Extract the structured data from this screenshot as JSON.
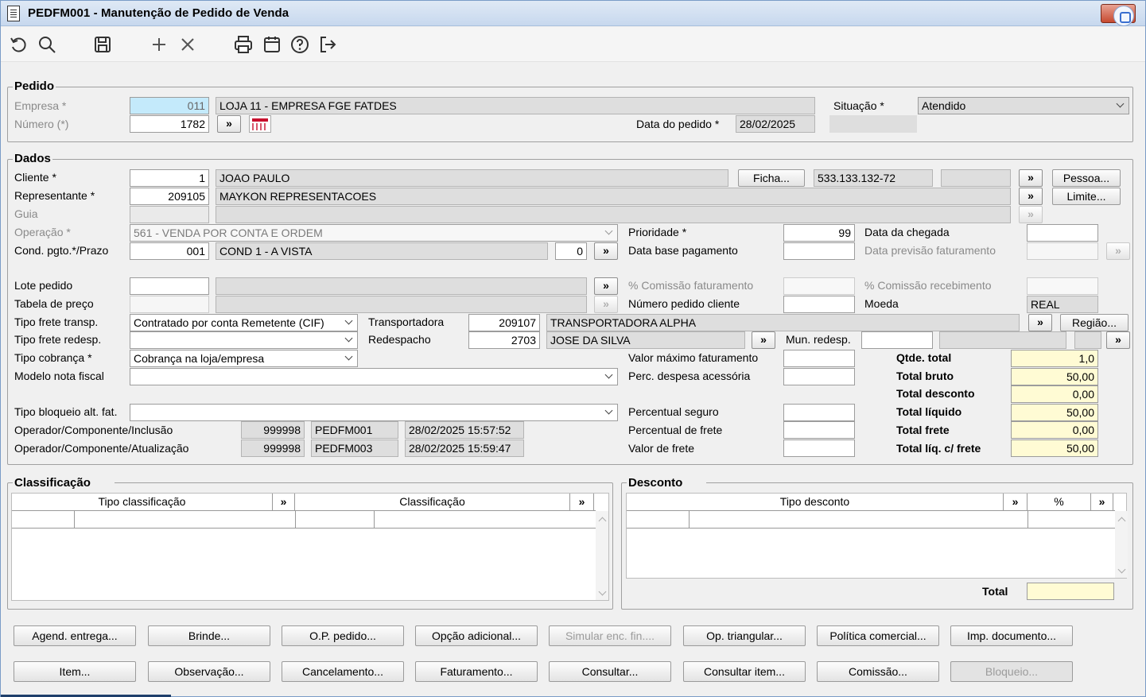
{
  "window": {
    "title": "PEDFM001 - Manutenção de Pedido de Venda"
  },
  "toolbar": {
    "icons": [
      "undo-icon",
      "search-icon",
      "save-icon",
      "add-icon",
      "delete-icon",
      "print-icon",
      "calendar-icon",
      "help-icon",
      "exit-icon"
    ]
  },
  "pedido": {
    "title": "Pedido",
    "empresa_label": "Empresa *",
    "empresa_code": "011",
    "empresa_name": "LOJA 11 - EMPRESA FGE FATDES",
    "numero_label": "Número (*)",
    "numero": "1782",
    "situacao_label": "Situação *",
    "situacao": "Atendido",
    "data_label": "Data do pedido *",
    "data": "28/02/2025"
  },
  "dados": {
    "title": "Dados",
    "cliente_label": "Cliente *",
    "cliente_code": "1",
    "cliente_name": "JOAO PAULO",
    "ficha_btn": "Ficha...",
    "cpf": "533.133.132-72",
    "pessoa_btn": "Pessoa...",
    "representante_label": "Representante *",
    "representante_code": "209105",
    "representante_name": "MAYKON REPRESENTACOES",
    "limite_btn": "Limite...",
    "guia_label": "Guia",
    "operacao_label": "Operação *",
    "operacao": "561 - VENDA POR CONTA E ORDEM",
    "prioridade_label": "Prioridade *",
    "prioridade": "99",
    "data_chegada_label": "Data da chegada",
    "cond_label": "Cond. pgto.*/Prazo",
    "cond_code": "001",
    "cond_name": "COND 1 - A VISTA",
    "prazo": "0",
    "data_base_label": "Data base pagamento",
    "data_prev_label": "Data previsão faturamento",
    "lote_label": "Lote pedido",
    "comissao_fat_label": "% Comissão faturamento",
    "comissao_rec_label": "% Comissão recebimento",
    "tabela_label": "Tabela de preço",
    "num_pedido_cli_label": "Número pedido cliente",
    "moeda_label": "Moeda",
    "moeda": "REAL",
    "frete_transp_label": "Tipo frete transp.",
    "frete_transp": "Contratado por conta Remetente (CIF)",
    "transportadora_label": "Transportadora",
    "transportadora_code": "209107",
    "transportadora_name": "TRANSPORTADORA ALPHA",
    "regiao_btn": "Região...",
    "frete_redesp_label": "Tipo frete redesp.",
    "redespacho_label": "Redespacho",
    "redespacho_code": "2703",
    "redespacho_name": "JOSE DA SILVA",
    "mun_redesp_label": "Mun. redesp.",
    "cobranca_label": "Tipo cobrança *",
    "cobranca": "Cobrança na loja/empresa",
    "valor_max_label": "Valor máximo faturamento",
    "modelo_label": "Modelo nota fiscal",
    "perc_desp_label": "Perc. despesa acessória",
    "bloqueio_label": "Tipo bloqueio alt. fat.",
    "perc_seguro_label": "Percentual seguro",
    "op_inclusao_label": "Operador/Componente/Inclusão",
    "op_inclusao_code": "999998",
    "op_inclusao_comp": "PEDFM001",
    "op_inclusao_date": "28/02/2025 15:57:52",
    "perc_frete_label": "Percentual de frete",
    "op_atual_label": "Operador/Componente/Atualização",
    "op_atual_code": "999998",
    "op_atual_comp": "PEDFM003",
    "op_atual_date": "28/02/2025 15:59:47",
    "valor_frete_label": "Valor de frete"
  },
  "totais": {
    "qtde_label": "Qtde. total",
    "qtde": "1,0",
    "bruto_label": "Total bruto",
    "bruto": "50,00",
    "desconto_label": "Total desconto",
    "desconto": "0,00",
    "liquido_label": "Total líquido",
    "liquido": "50,00",
    "frete_label": "Total frete",
    "frete": "0,00",
    "liq_frete_label": "Total líq. c/ frete",
    "liq_frete": "50,00"
  },
  "classificacao": {
    "title": "Classificação",
    "col_tipo": "Tipo classificação",
    "col_class": "Classificação"
  },
  "desconto": {
    "title": "Desconto",
    "col_tipo": "Tipo desconto",
    "col_pct": "%",
    "total_label": "Total"
  },
  "buttons": {
    "row1": [
      "Agend. entrega...",
      "Brinde...",
      "O.P. pedido...",
      "Opção adicional...",
      "Simular enc. fin....",
      "Op. triangular...",
      "Política comercial...",
      "Imp. documento..."
    ],
    "row2": [
      "Item...",
      "Observação...",
      "Cancelamento...",
      "Faturamento...",
      "Consultar...",
      "Consultar item...",
      "Comissão...",
      "Bloqueio..."
    ]
  }
}
